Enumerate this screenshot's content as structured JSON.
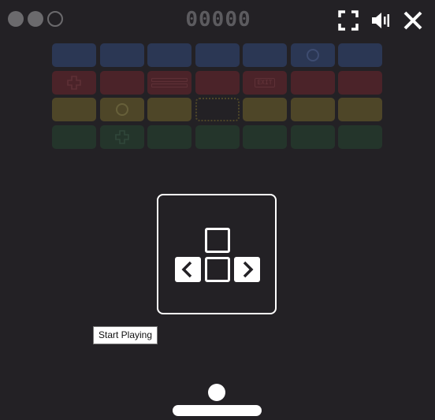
{
  "hud": {
    "lives_full": 2,
    "lives_total": 3,
    "score": "00000"
  },
  "controls": {
    "fullscreen_icon": "fullscreen-icon",
    "sound_icon": "volume-icon",
    "close_icon": "close-icon"
  },
  "bricks": {
    "rows": [
      {
        "color": "blue",
        "items": [
          "",
          "",
          "",
          "",
          "",
          "circle",
          ""
        ]
      },
      {
        "color": "red",
        "items": [
          "plus",
          "",
          "stack",
          "",
          "exit",
          "",
          ""
        ]
      },
      {
        "color": "yellow",
        "items": [
          "",
          "circle",
          "",
          "ghost",
          "",
          "",
          ""
        ]
      },
      {
        "color": "green",
        "items": [
          "",
          "plus",
          "",
          "",
          "",
          "",
          ""
        ]
      }
    ],
    "exit_label": "EXIT"
  },
  "instructions": {
    "keys": [
      "up-arrow-key",
      "left-arrow-key",
      "down-arrow-key",
      "right-arrow-key"
    ]
  },
  "tooltip": {
    "text": "Start Playing"
  },
  "colors": {
    "background": "#232125",
    "blue": "#2b3754",
    "red": "#4b2329",
    "yellow": "#4e4628",
    "green": "#24352b",
    "foreground": "#ffffff"
  }
}
